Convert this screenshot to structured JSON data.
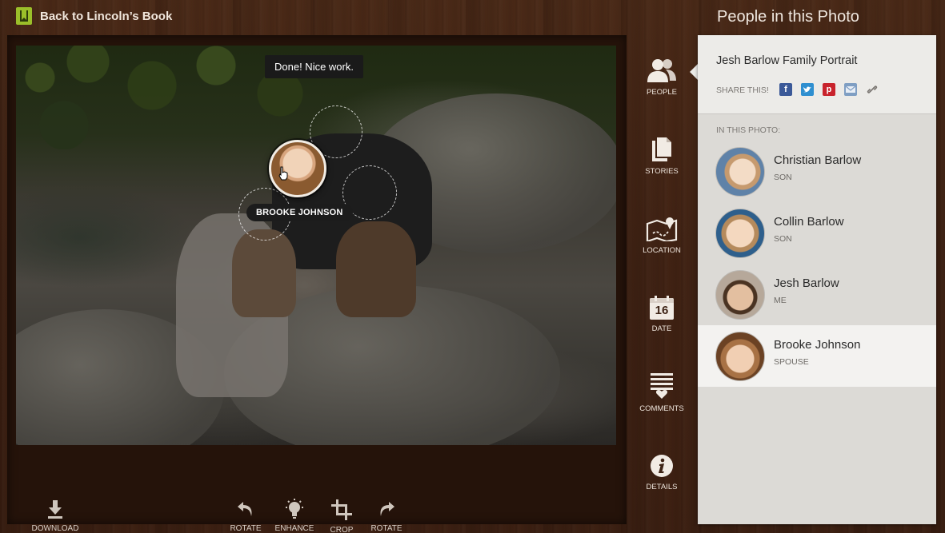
{
  "header": {
    "back_label": "Back to Lincoln’s Book",
    "panel_title": "People in this Photo"
  },
  "photo": {
    "toast": "Done! Nice work.",
    "active_tag": "BROOKE JOHNSON"
  },
  "toolbar": {
    "download": "DOWNLOAD",
    "rotate_left": "ROTATE",
    "enhance": "ENHANCE",
    "crop": "CROP",
    "rotate_right": "ROTATE"
  },
  "rail": {
    "people": "PEOPLE",
    "stories": "STORIES",
    "location": "LOCATION",
    "date_num": "16",
    "date": "DATE",
    "comments": "COMMENTS",
    "details": "DETAILS"
  },
  "panel": {
    "photo_title": "Jesh Barlow Family Portrait",
    "share_label": "SHARE THIS!",
    "share_icons": [
      "facebook-icon",
      "twitter-icon",
      "pinterest-icon",
      "email-icon",
      "link-icon"
    ],
    "section_label": "IN THIS PHOTO:",
    "people": [
      {
        "name": "Christian Barlow",
        "relation": "SON"
      },
      {
        "name": "Collin Barlow",
        "relation": "SON"
      },
      {
        "name": "Jesh Barlow",
        "relation": "ME"
      },
      {
        "name": "Brooke Johnson",
        "relation": "SPOUSE"
      }
    ],
    "selected_person": "Brooke Johnson"
  },
  "colors": {
    "wood": "#3f2214",
    "panel": "#dcdad6",
    "facebook": "#3b5998",
    "twitter": "#2f8fd0",
    "pinterest": "#c8232c",
    "book_icon": "#9bbf2a"
  }
}
